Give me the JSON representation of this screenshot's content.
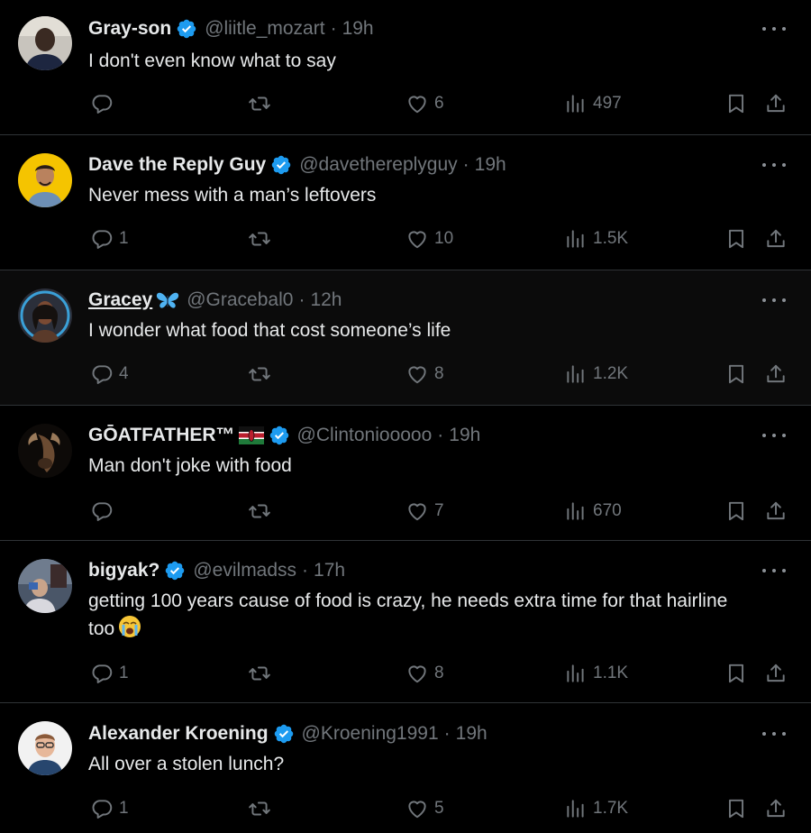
{
  "colors": {
    "background": "#000000",
    "text": "#e7e9ea",
    "muted": "#71767b",
    "divider": "#2f3336",
    "verified": "#1d9bf0"
  },
  "tweets": [
    {
      "name": "Gray-son",
      "handle": "@liitle_mozart",
      "time": "19h",
      "text": "I don't even know what to say",
      "replies": "",
      "likes": "6",
      "views": "497",
      "verified": true
    },
    {
      "name": "Dave the Reply Guy",
      "handle": "@davethereplyguy",
      "time": "19h",
      "text": "Never mess with a man’s leftovers",
      "replies": "1",
      "likes": "10",
      "views": "1.5K",
      "verified": true
    },
    {
      "name": "Gracey",
      "name_emoji": "butterfly",
      "handle": "@Gracebal0",
      "time": "12h",
      "text": "I wonder what food that cost someone’s life",
      "replies": "4",
      "likes": "8",
      "views": "1.2K",
      "verified": false
    },
    {
      "name": "GŌATFATHER™",
      "name_emoji": "kenya-flag",
      "handle": "@Clintonioo​ooo",
      "time": "19h",
      "text": "Man don't joke with food",
      "replies": "",
      "likes": "7",
      "views": "670",
      "verified": true
    },
    {
      "name": "bigyak?",
      "handle": "@evilmadss",
      "time": "17h",
      "text": "getting 100 years cause of food is crazy, he needs extra time for that hairline too",
      "text_emoji": "loudly-crying-face",
      "replies": "1",
      "likes": "8",
      "views": "1.1K",
      "verified": true
    },
    {
      "name": "Alexander Kroening",
      "handle": "@Kroening1991",
      "time": "19h",
      "text": "All over a stolen lunch?",
      "replies": "1",
      "likes": "5",
      "views": "1.7K",
      "verified": true
    }
  ],
  "icons": {
    "reply": "reply-icon",
    "retweet": "retweet-icon",
    "like": "heart-icon",
    "views": "views-icon",
    "bookmark": "bookmark-icon",
    "share": "share-icon",
    "more": "more-icon",
    "verified": "verified-badge-icon"
  },
  "separator": "·"
}
